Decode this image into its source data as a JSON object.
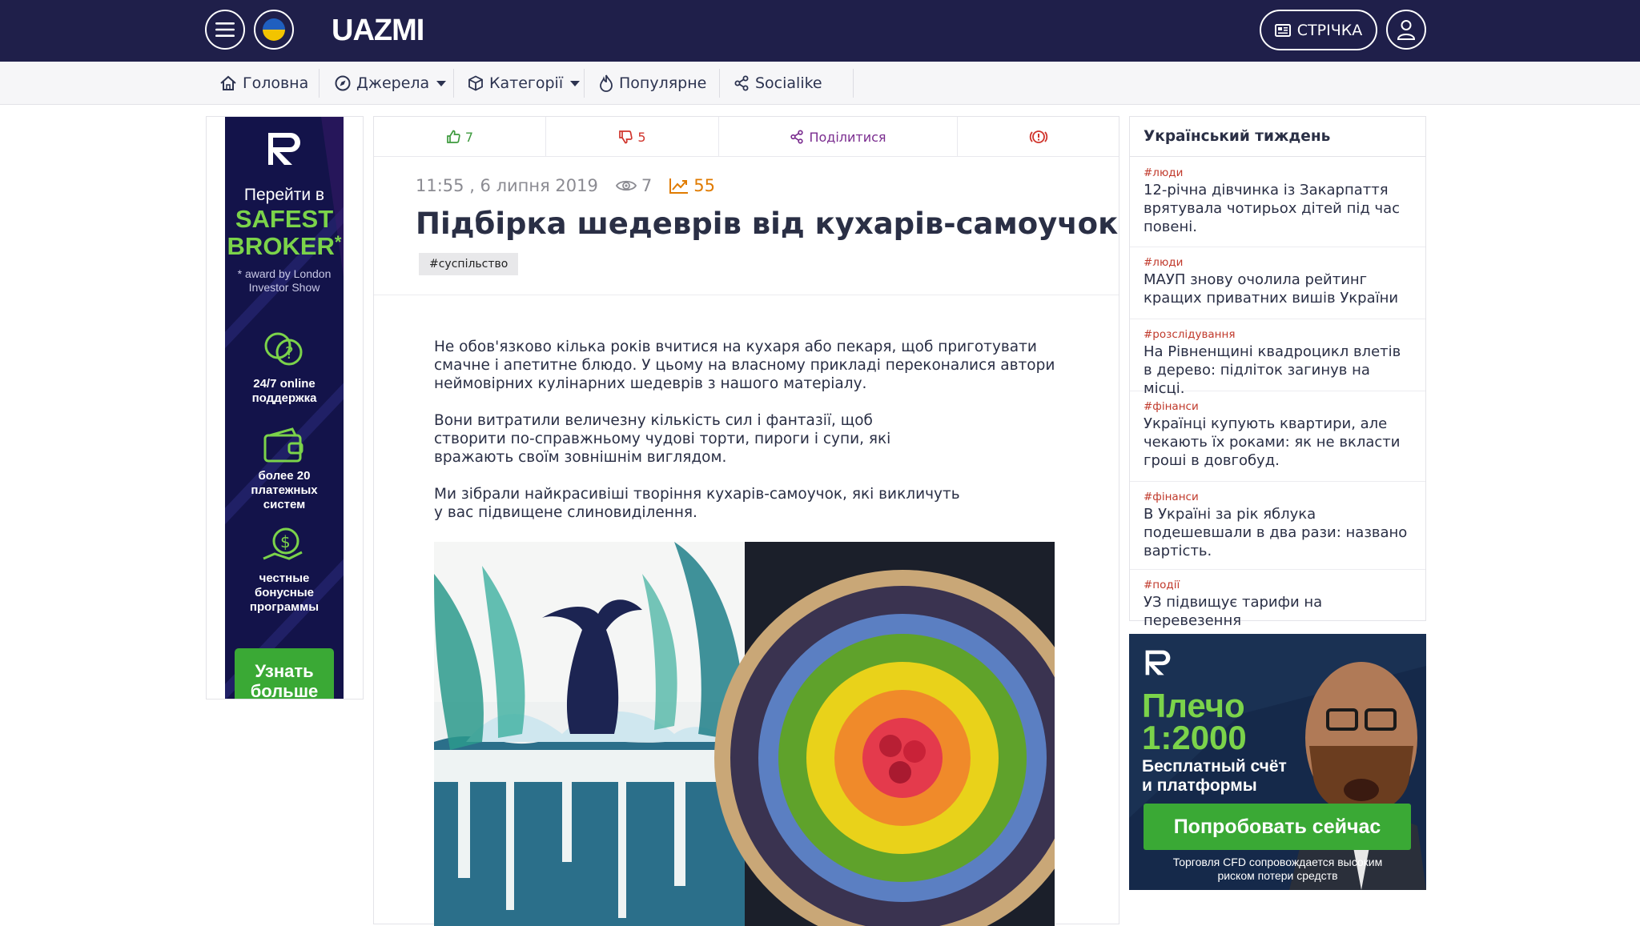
{
  "header": {
    "logo": "UAZMI",
    "feed_label": "СТРІЧКА"
  },
  "nav": {
    "items": [
      {
        "label": "Головна"
      },
      {
        "label": "Джерела"
      },
      {
        "label": "Категорії"
      },
      {
        "label": "Популярне"
      },
      {
        "label": "Socialike"
      }
    ]
  },
  "left_ad": {
    "go_to": "Перейти в",
    "safest": "SAFEST",
    "broker": "BROKER",
    "star": "*",
    "award": "* award by London Investor Show",
    "f1": "24/7 online поддержка",
    "f2": "более 20 платежных систем",
    "f3": "честные бонусные программы",
    "cta": "Узнать больше"
  },
  "article": {
    "likes": "7",
    "dislikes": "5",
    "share_label": "Поділитися",
    "datetime": "11:55 , 6 липня 2019",
    "views": "7",
    "rating": "55",
    "title": "Підбірка шедеврів від кухарів-самоучок",
    "tag": "#суспільство",
    "paragraphs": [
      "Не обов'язково кілька років вчитися на кухаря або пекаря, щоб приготувати смачне і апетитне блюдо. У цьому на власному прикладі переконалися автори неймовірних кулінарних шедеврів з нашого матеріалу.",
      "Вони витратили величезну кількість сил і фантазії, щоб створити по-справжньому чудові торти, пироги і супи, які вражають своїм зовнішнім виглядом.",
      "Ми зібрали найкрасивіші творіння кухарів-самоучок, які викличуть у вас підвищене слиновиділення."
    ]
  },
  "sidebar": {
    "title": "Український тиждень",
    "news": [
      {
        "tag": "#люди",
        "headline": "12-річна дівчинка із Закарпаття врятувала чотирьох дітей під час повені."
      },
      {
        "tag": "#люди",
        "headline": "МАУП знову очолила рейтинг кращих приватних вишів України"
      },
      {
        "tag": "#розслідування",
        "headline": "На Рівненщині квадроцикл влетів в дерево: підліток загинув на місці."
      },
      {
        "tag": "#фінанси",
        "headline": "Українці купують квартири, але чекають їх роками: як не вкласти гроші в довгобуд."
      },
      {
        "tag": "#фінанси",
        "headline": "В Україні за рік яблука подешевшали в два рази: названо вартість."
      },
      {
        "tag": "#події",
        "headline": "УЗ підвищує тарифи на перевезення"
      }
    ]
  },
  "right_ad": {
    "leverage_1": "Плечо",
    "leverage_2": "1:2000",
    "sub_1": "Бесплатный счёт",
    "sub_2": "и платформы",
    "cta": "Попробовать сейчас",
    "disclaimer_1": "Торговля CFD сопровождается высоким",
    "disclaimer_2": "риском потери средств"
  },
  "colors": {
    "header_bg": "#1f1f4a",
    "like_green": "#3d9a3d",
    "dislike_red": "#d0342c",
    "share_purple": "#7a2c8f",
    "rating_orange": "#e07b00",
    "tag_red": "#c0392b",
    "ad_green": "#3aa935"
  }
}
